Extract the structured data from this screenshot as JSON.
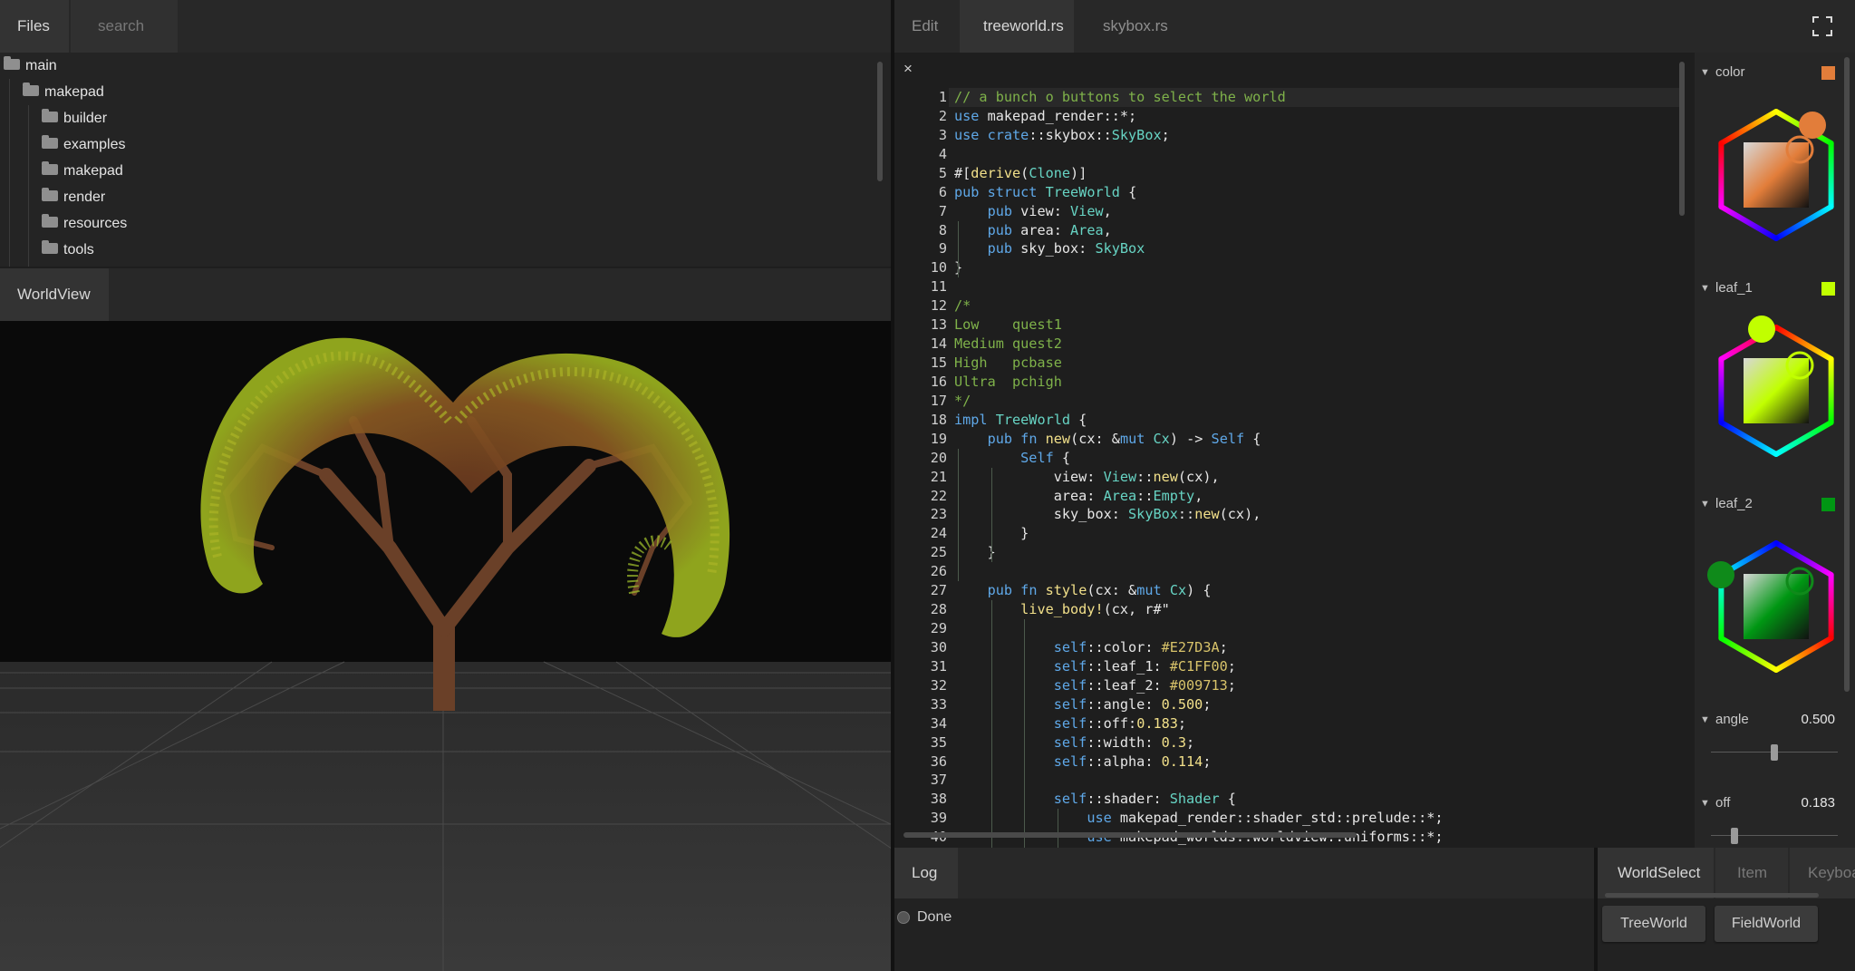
{
  "files_panel": {
    "tabs": [
      "Files",
      "search"
    ],
    "tree": [
      {
        "label": "main",
        "depth": 0
      },
      {
        "label": "makepad",
        "depth": 1
      },
      {
        "label": "builder",
        "depth": 2
      },
      {
        "label": "examples",
        "depth": 2
      },
      {
        "label": "makepad",
        "depth": 2
      },
      {
        "label": "render",
        "depth": 2
      },
      {
        "label": "resources",
        "depth": 2
      },
      {
        "label": "tools",
        "depth": 2
      }
    ]
  },
  "world_panel": {
    "tab": "WorldView"
  },
  "editor": {
    "tabs": [
      "Edit",
      "treeworld.rs",
      "skybox.rs"
    ],
    "close_glyph": "×",
    "lines": [
      "// a bunch o buttons to select the world",
      "use makepad_render::*;",
      "use crate::skybox::SkyBox;",
      "",
      "#[derive(Clone)]",
      "pub struct TreeWorld {",
      "    pub view: View,",
      "    pub area: Area,",
      "    pub sky_box: SkyBox",
      "}",
      "",
      "/*",
      "Low    quest1",
      "Medium quest2",
      "High   pcbase",
      "Ultra  pchigh",
      "*/",
      "impl TreeWorld {",
      "    pub fn new(cx: &mut Cx) -> Self {",
      "        Self {",
      "            view: View::new(cx),",
      "            area: Area::Empty,",
      "            sky_box: SkyBox::new(cx),",
      "        }",
      "    }",
      "",
      "    pub fn style(cx: &mut Cx) {",
      "        live_body!(cx, r#\"",
      "",
      "            self::color: #E27D3A;",
      "            self::leaf_1: #C1FF00;",
      "            self::leaf_2: #009713;",
      "            self::angle: 0.500;",
      "            self::off:0.183;",
      "            self::width: 0.3;",
      "            self::alpha: 0.114;",
      "",
      "            self::shader: Shader {",
      "                use makepad_render::shader_std::prelude::*;",
      "                use makepad_worlds::worldview::uniforms::*;"
    ]
  },
  "inspector": {
    "colors": [
      {
        "name": "color",
        "hex": "#E27D3A",
        "handle": "#E27D3A",
        "hue_angle": 30
      },
      {
        "name": "leaf_1",
        "hex": "#C1FF00",
        "handle": "#C1FF00",
        "hue_angle": 330
      },
      {
        "name": "leaf_2",
        "hex": "#009713",
        "handle": "#0f8a1a",
        "hue_angle": 210
      }
    ],
    "sliders": [
      {
        "name": "angle",
        "value": "0.500",
        "fraction": 0.5
      },
      {
        "name": "off",
        "value": "0.183",
        "fraction": 0.183
      }
    ]
  },
  "log_panel": {
    "tab": "Log",
    "entry": "Done"
  },
  "world_select": {
    "tabs": [
      "WorldSelect",
      "Item",
      "Keyboa"
    ],
    "buttons": [
      "TreeWorld",
      "FieldWorld"
    ]
  },
  "theme": {
    "comment": "#7fb24a",
    "keyword": "#5fa8e8",
    "type": "#67d4c4",
    "func": "#f2e08a",
    "number": "#f2e08a",
    "hexcolor": "#d8c36a"
  }
}
